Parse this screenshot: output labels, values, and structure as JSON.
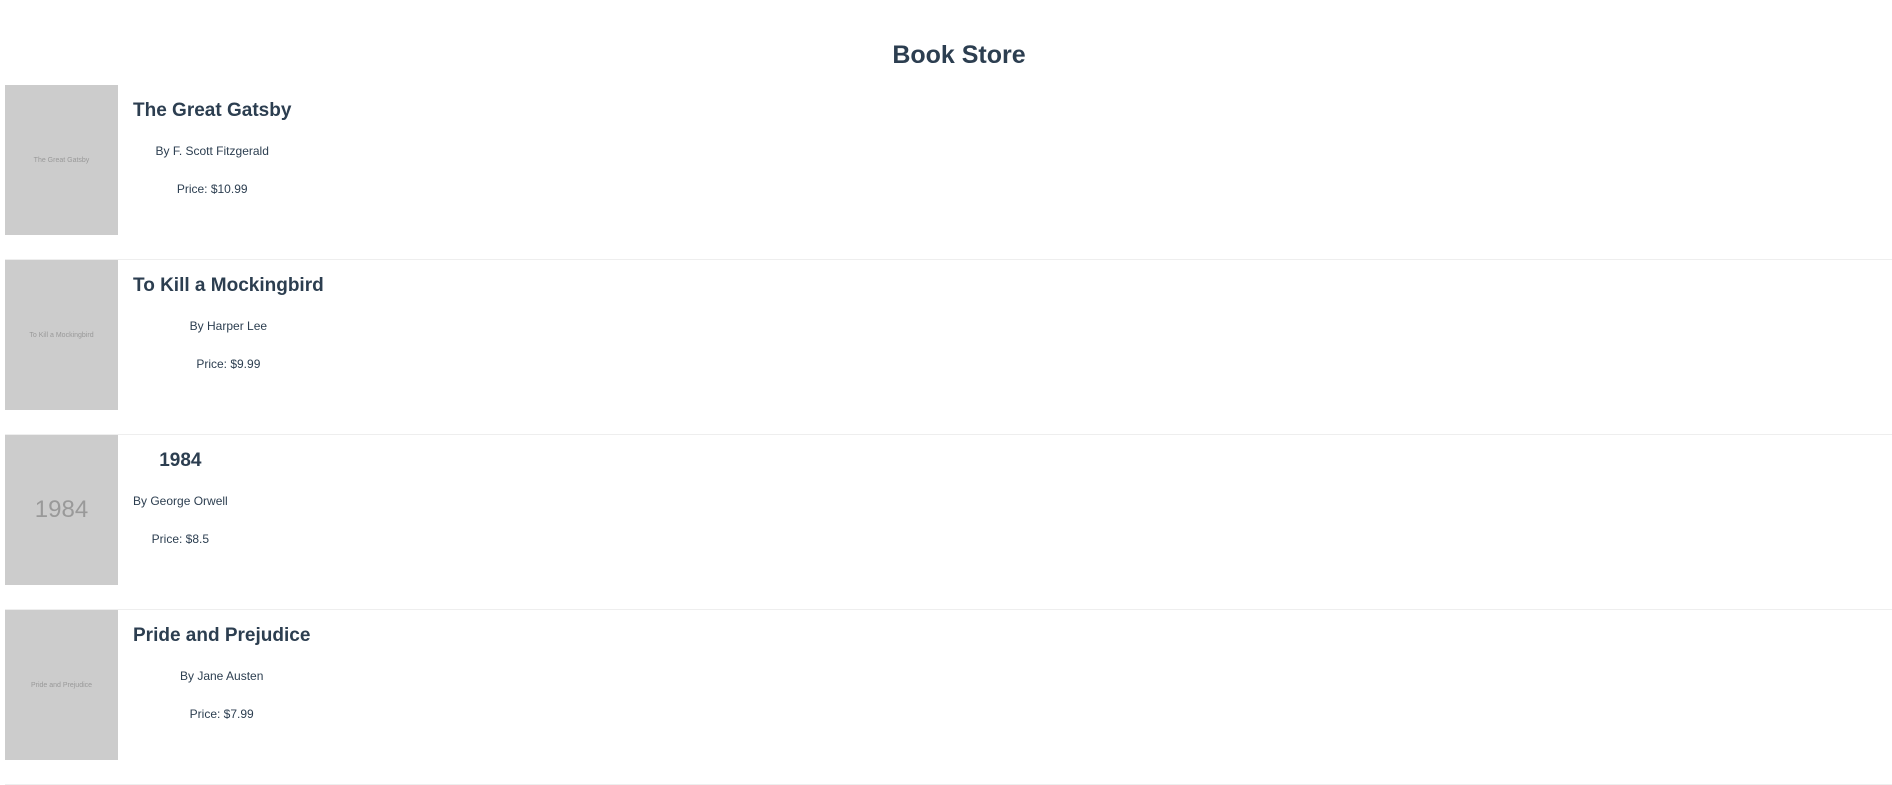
{
  "store": {
    "title": "Book Store"
  },
  "books": [
    {
      "cover_text": "The Great Gatsby",
      "title": "The Great Gatsby",
      "author": "By F. Scott Fitzgerald",
      "price": "Price: $10.99"
    },
    {
      "cover_text": "To Kill a Mockingbird",
      "title": "To Kill a Mockingbird",
      "author": "By Harper Lee",
      "price": "Price: $9.99"
    },
    {
      "cover_text": "1984",
      "title": "1984",
      "author": "By George Orwell",
      "price": "Price: $8.5"
    },
    {
      "cover_text": "Pride and Prejudice",
      "title": "Pride and Prejudice",
      "author": "By Jane Austen",
      "price": "Price: $7.99"
    }
  ],
  "colors": {
    "text": "#2c3e50",
    "cover_bg": "#cccccc",
    "cover_text": "#999999",
    "divider": "#eeeeee"
  }
}
